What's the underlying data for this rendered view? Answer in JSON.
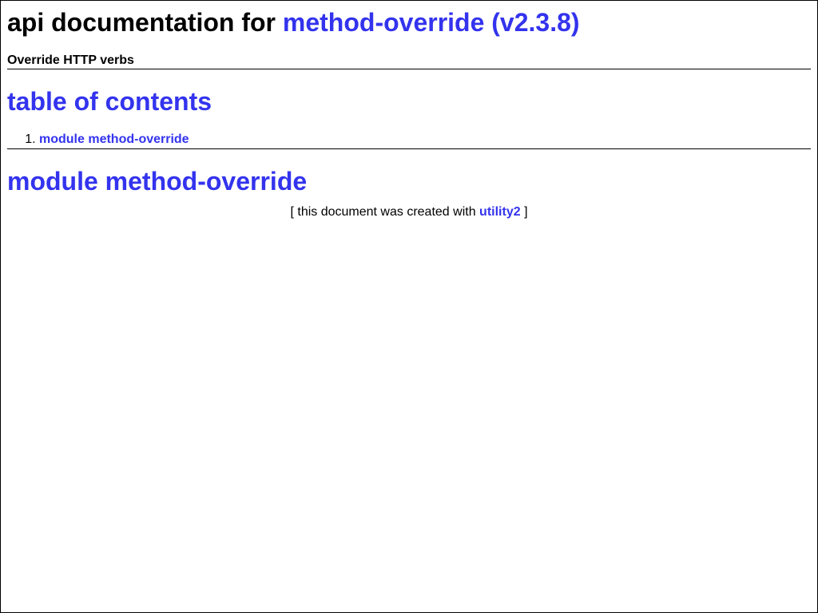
{
  "header": {
    "title_prefix": "api documentation for",
    "title_link": "method-override (v2.3.8)",
    "subtitle": "Override HTTP verbs"
  },
  "toc": {
    "heading": "table of contents",
    "items": [
      {
        "label": "module method-override"
      }
    ]
  },
  "module": {
    "heading": "module method-override"
  },
  "footer": {
    "text_before": "[ this document was created with",
    "link": "utility2",
    "text_after": "]"
  },
  "colors": {
    "link": "#3333ee",
    "text": "#000000",
    "background": "#ffffff"
  }
}
